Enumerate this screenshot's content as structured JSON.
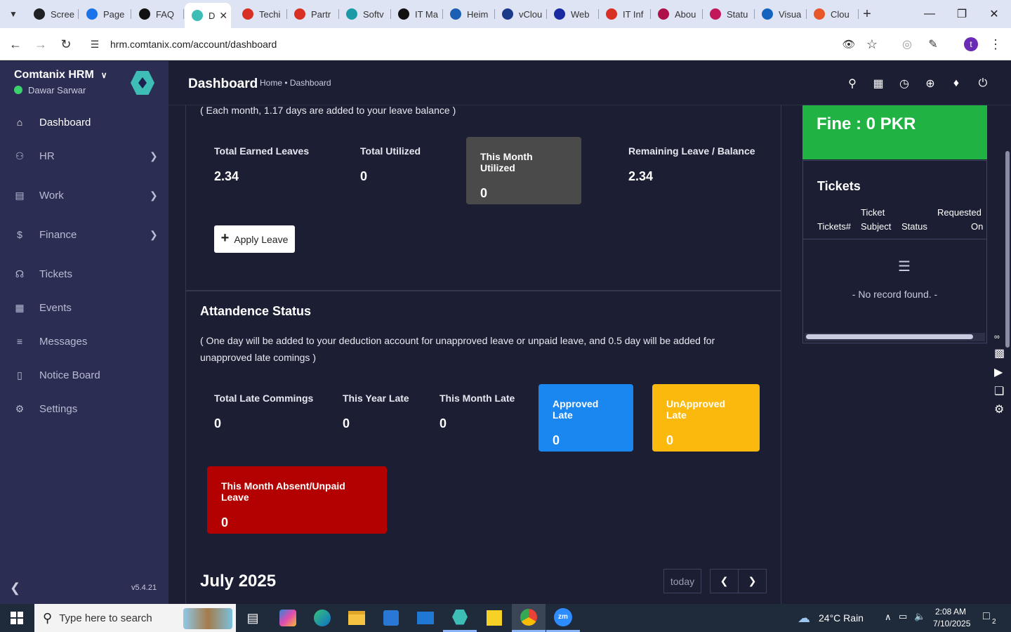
{
  "browser": {
    "tabs": [
      {
        "label": "Scree",
        "favicon_color": "#202124"
      },
      {
        "label": "Page",
        "favicon_color": "#1a73e8"
      },
      {
        "label": "FAQ",
        "favicon_color": "#111111"
      },
      {
        "label": "D",
        "favicon_color": "#3dbdb6",
        "active": true
      },
      {
        "label": "Techi",
        "favicon_color": "#d93025"
      },
      {
        "label": "Partr",
        "favicon_color": "#d93025"
      },
      {
        "label": "Softv",
        "favicon_color": "#1a9aa6"
      },
      {
        "label": "IT Ma",
        "favicon_color": "#111111"
      },
      {
        "label": "Heim",
        "favicon_color": "#1a5fb4"
      },
      {
        "label": "vClou",
        "favicon_color": "#1a3a8a"
      },
      {
        "label": "Web",
        "favicon_color": "#1a2aa0"
      },
      {
        "label": "IT Inf",
        "favicon_color": "#d93025"
      },
      {
        "label": "Abou",
        "favicon_color": "#b0104a"
      },
      {
        "label": "Statu",
        "favicon_color": "#c2185b"
      },
      {
        "label": "Visua",
        "favicon_color": "#1565c0"
      },
      {
        "label": "Clou",
        "favicon_color": "#e8572a"
      }
    ],
    "url": "hrm.comtanix.com/account/dashboard",
    "profile_initial": "t"
  },
  "sidebar": {
    "brand": "Comtanix HRM",
    "user": "Dawar Sarwar",
    "version": "v5.4.21",
    "items": [
      {
        "label": "Dashboard",
        "icon": "home-icon",
        "active": true
      },
      {
        "label": "HR",
        "icon": "users-icon",
        "has_children": true
      },
      {
        "label": "Work",
        "icon": "briefcase-icon",
        "has_children": true
      },
      {
        "label": "Finance",
        "icon": "dollar-icon",
        "has_children": true
      },
      {
        "label": "Tickets",
        "icon": "headset-icon"
      },
      {
        "label": "Events",
        "icon": "calendar-icon"
      },
      {
        "label": "Messages",
        "icon": "message-icon"
      },
      {
        "label": "Notice Board",
        "icon": "clipboard-icon"
      },
      {
        "label": "Settings",
        "icon": "gear-icon"
      }
    ]
  },
  "header": {
    "title": "Dashboard",
    "breadcrumb": "Home • Dashboard"
  },
  "leave": {
    "note": "( Each month, 1.17 days are added to your leave balance )",
    "total_earned_label": "Total Earned Leaves",
    "total_earned_value": "2.34",
    "total_utilized_label": "Total Utilized",
    "total_utilized_value": "0",
    "month_utilized_label": "This Month Utilized",
    "month_utilized_value": "0",
    "remaining_label": "Remaining Leave / Balance",
    "remaining_value": "2.34",
    "apply_button": "Apply Leave"
  },
  "attendance": {
    "title": "Attandence Status",
    "note": "( One day will be added to your deduction account for unapproved leave or unpaid leave, and 0.5 day will be added for unapproved late comings )",
    "total_late_label": "Total Late Commings",
    "total_late_value": "0",
    "year_late_label": "This Year Late",
    "year_late_value": "0",
    "month_late_label": "This Month Late",
    "month_late_value": "0",
    "approved_late_label": "Approved Late",
    "approved_late_value": "0",
    "unapproved_late_label": "UnApproved Late",
    "unapproved_late_value": "0",
    "absent_label": "This Month Absent/Unpaid Leave",
    "absent_value": "0",
    "colors": {
      "approved": "#1a87f1",
      "unapproved": "#fcb90d",
      "absent": "#b30000",
      "month_utilized": "#4a4a4a"
    }
  },
  "calendar": {
    "title": "July 2025",
    "today_button": "today"
  },
  "fine": {
    "text": "Fine : 0 PKR",
    "color": "#20b243"
  },
  "tickets": {
    "title": "Tickets",
    "col_ticket_no": "Tickets#",
    "col_subject_1": "Ticket",
    "col_subject_2": "Subject",
    "col_status": "Status",
    "col_requested_1": "Requested",
    "col_requested_2": "On",
    "empty": "- No record found. -"
  },
  "taskbar": {
    "search_placeholder": "Type here to search",
    "weather": "24°C  Rain",
    "time": "2:08 AM",
    "date": "7/10/2025",
    "notification_count": "2"
  }
}
